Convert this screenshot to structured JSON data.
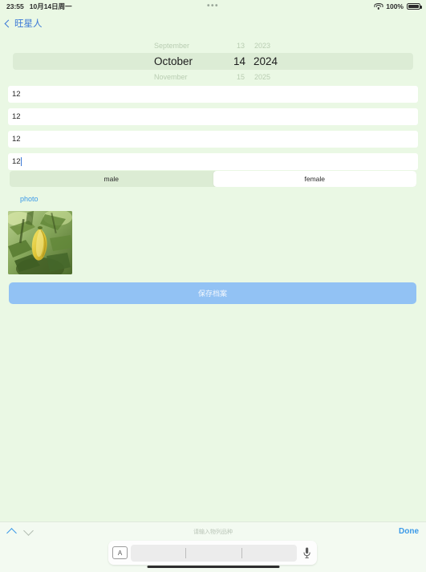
{
  "status_bar": {
    "time": "23:55",
    "date": "10月14日周一",
    "center_dots": "•••",
    "battery_percent": "100%",
    "wifi_icon": "wifi-icon",
    "battery_icon": "battery-full-icon"
  },
  "nav": {
    "back_label": "旺星人",
    "back_icon": "chevron-left-icon"
  },
  "date_picker": {
    "rows": [
      {
        "month": "September",
        "day": "13",
        "year": "2023"
      },
      {
        "month": "October",
        "day": "14",
        "year": "2024"
      },
      {
        "month": "November",
        "day": "15",
        "year": "2025"
      }
    ],
    "selected_index": 1
  },
  "fields": [
    {
      "name": "field-1",
      "value": "12",
      "focused": false
    },
    {
      "name": "field-2",
      "value": "12",
      "focused": false
    },
    {
      "name": "field-3",
      "value": "12",
      "focused": false
    },
    {
      "name": "field-4",
      "value": "12",
      "focused": true
    }
  ],
  "gender": {
    "options": [
      {
        "label": "male",
        "selected": false
      },
      {
        "label": "female",
        "selected": true
      }
    ]
  },
  "photo": {
    "label": "photo",
    "thumbnail_alt": "yellow-starfruit-on-tree"
  },
  "save_button": {
    "label": "保存档案"
  },
  "keyboard_bar": {
    "hint": "请输入物列品种",
    "done_label": "Done",
    "prev_icon": "chevron-up-icon",
    "next_icon": "chevron-down-icon",
    "layout_icon": "A",
    "mic_icon": "microphone-icon",
    "suggestions": [
      "",
      "",
      ""
    ]
  },
  "colors": {
    "background": "#eaf8e4",
    "accent_blue": "#3c9ae8",
    "save_button": "#92c2f4",
    "field_bg": "#ffffff",
    "segment_bg": "#dcecd4"
  }
}
